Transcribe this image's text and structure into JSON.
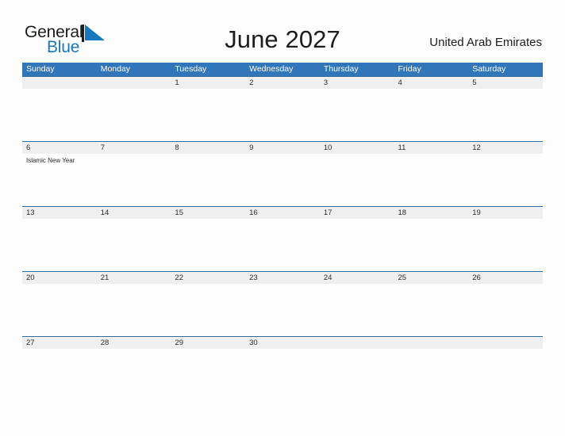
{
  "brand": {
    "name_part1": "General",
    "name_part2": "Blue",
    "flag_icon": "blue-triangle-flag-icon",
    "accent_color": "#1878be"
  },
  "header": {
    "title": "June 2027",
    "region": "United Arab Emirates"
  },
  "calendar": {
    "month": "June",
    "year": "2027",
    "header_bg_color": "#3076b8",
    "date_band_color": "#efefef",
    "date_band_border_color": "#2e6da4",
    "day_headers": [
      "Sunday",
      "Monday",
      "Tuesday",
      "Wednesday",
      "Thursday",
      "Friday",
      "Saturday"
    ],
    "weeks": [
      {
        "days": [
          {
            "date": "",
            "events": []
          },
          {
            "date": "",
            "events": []
          },
          {
            "date": "1",
            "events": []
          },
          {
            "date": "2",
            "events": []
          },
          {
            "date": "3",
            "events": []
          },
          {
            "date": "4",
            "events": []
          },
          {
            "date": "5",
            "events": []
          }
        ]
      },
      {
        "days": [
          {
            "date": "6",
            "events": [
              "Islamic New Year"
            ]
          },
          {
            "date": "7",
            "events": []
          },
          {
            "date": "8",
            "events": []
          },
          {
            "date": "9",
            "events": []
          },
          {
            "date": "10",
            "events": []
          },
          {
            "date": "11",
            "events": []
          },
          {
            "date": "12",
            "events": []
          }
        ]
      },
      {
        "days": [
          {
            "date": "13",
            "events": []
          },
          {
            "date": "14",
            "events": []
          },
          {
            "date": "15",
            "events": []
          },
          {
            "date": "16",
            "events": []
          },
          {
            "date": "17",
            "events": []
          },
          {
            "date": "18",
            "events": []
          },
          {
            "date": "19",
            "events": []
          }
        ]
      },
      {
        "days": [
          {
            "date": "20",
            "events": []
          },
          {
            "date": "21",
            "events": []
          },
          {
            "date": "22",
            "events": []
          },
          {
            "date": "23",
            "events": []
          },
          {
            "date": "24",
            "events": []
          },
          {
            "date": "25",
            "events": []
          },
          {
            "date": "26",
            "events": []
          }
        ]
      },
      {
        "days": [
          {
            "date": "27",
            "events": []
          },
          {
            "date": "28",
            "events": []
          },
          {
            "date": "29",
            "events": []
          },
          {
            "date": "30",
            "events": []
          },
          {
            "date": "",
            "events": []
          },
          {
            "date": "",
            "events": []
          },
          {
            "date": "",
            "events": []
          }
        ]
      }
    ]
  }
}
